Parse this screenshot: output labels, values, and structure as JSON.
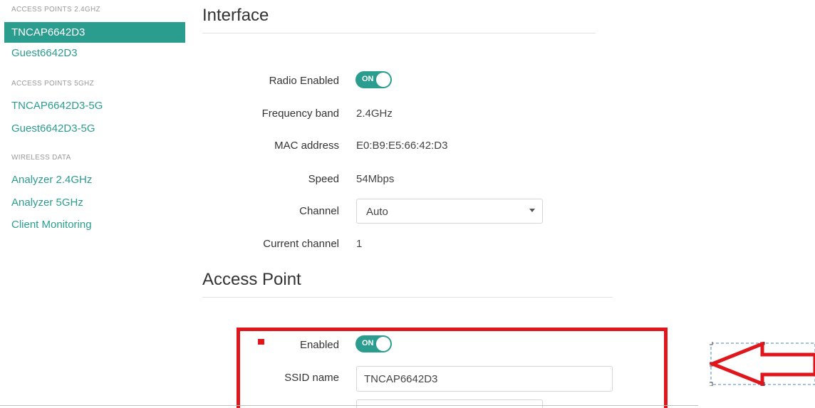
{
  "sidebar": {
    "header_24": "ACCESS POINTS 2.4GHZ",
    "items_24": [
      {
        "label": "TNCAP6642D3",
        "active": true
      },
      {
        "label": "Guest6642D3",
        "active": false
      }
    ],
    "header_5": "ACCESS POINTS 5GHZ",
    "items_5": [
      {
        "label": "TNCAP6642D3-5G"
      },
      {
        "label": "Guest6642D3-5G"
      }
    ],
    "header_wireless": "WIRELESS DATA",
    "items_wireless": [
      {
        "label": "Analyzer 2.4GHz"
      },
      {
        "label": "Analyzer 5GHz"
      },
      {
        "label": "Client Monitoring"
      }
    ]
  },
  "interface": {
    "title": "Interface",
    "radio_enabled_label": "Radio Enabled",
    "radio_toggle_text": "ON",
    "frequency_band_label": "Frequency band",
    "frequency_band_value": "2.4GHz",
    "mac_label": "MAC address",
    "mac_value": "E0:B9:E5:66:42:D3",
    "speed_label": "Speed",
    "speed_value": "54Mbps",
    "channel_label": "Channel",
    "channel_value": "Auto",
    "current_channel_label": "Current channel",
    "current_channel_value": "1"
  },
  "access_point": {
    "title": "Access Point",
    "enabled_label": "Enabled",
    "enabled_toggle_text": "ON",
    "ssid_label": "SSID name",
    "ssid_value": "TNCAP6642D3"
  },
  "colors": {
    "accent": "#2a9d8f",
    "annotation": "#e0161d",
    "selection_handles": "#4a86c8"
  }
}
